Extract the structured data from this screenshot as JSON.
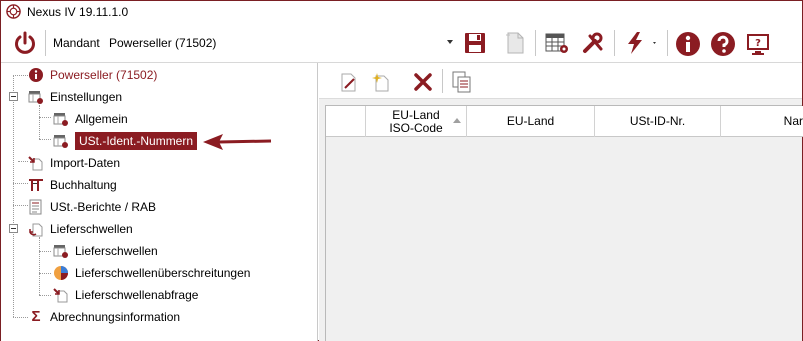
{
  "window": {
    "title": "Nexus IV 19.11.1.0"
  },
  "toolbar": {
    "mandant_label": "Mandant",
    "mandant_value": "Powerseller (71502)",
    "buttons": [
      "power-icon",
      "save-icon",
      "document-icon",
      "table-settings-icon",
      "tools-icon",
      "lightning-icon",
      "info-icon",
      "help-icon",
      "remote-support-icon"
    ]
  },
  "tree": {
    "items": [
      {
        "label": "Powerseller (71502)",
        "icon": "info-icon"
      },
      {
        "label": "Einstellungen",
        "icon": "settings-table-icon"
      },
      {
        "label": "Allgemein",
        "icon": "settings-table-icon"
      },
      {
        "label": "USt.-Ident.-Nummern",
        "icon": "settings-table-icon"
      },
      {
        "label": "Import-Daten",
        "icon": "import-icon"
      },
      {
        "label": "Buchhaltung",
        "icon": "ledger-icon"
      },
      {
        "label": "USt.-Berichte / RAB",
        "icon": "report-icon"
      },
      {
        "label": "Lieferschwellen",
        "icon": "delivery-icon"
      },
      {
        "label": "Lieferschwellen",
        "icon": "settings-table-icon"
      },
      {
        "label": "Lieferschwellenüberschreitungen",
        "icon": "pie-chart-icon"
      },
      {
        "label": "Lieferschwellenabfrage",
        "icon": "query-icon"
      },
      {
        "label": "Abrechnungsinformation",
        "icon": "sigma-icon"
      }
    ]
  },
  "grid": {
    "columns": [
      "EU-Land\nISO-Code",
      "EU-Land",
      "USt-ID-Nr.",
      "Nar"
    ]
  },
  "colors": {
    "accent": "#8b1c22",
    "toolbar_bg": "#ffffff",
    "panel_bg": "#f0f0f0"
  }
}
